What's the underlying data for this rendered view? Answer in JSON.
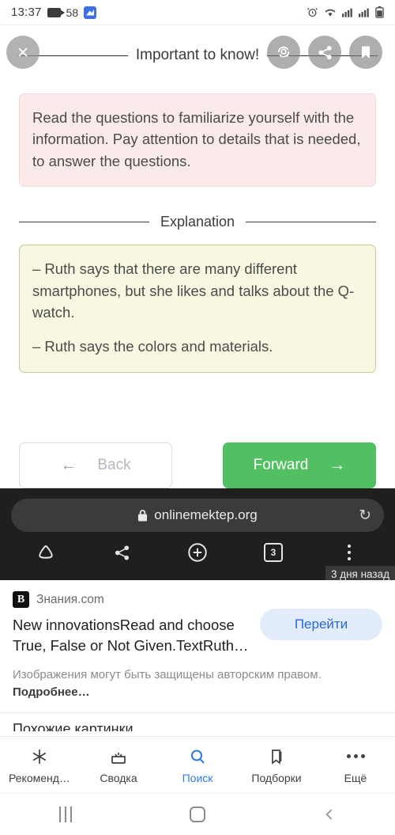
{
  "status_bar": {
    "time": "13:37",
    "notification_count": "58",
    "icons": [
      "video-recording-icon",
      "cleaner-icon",
      "alarm-icon",
      "wifi-icon",
      "signal-icon",
      "signal-icon",
      "battery-icon"
    ]
  },
  "overlay": {
    "close_label": "×",
    "buttons": [
      "close-icon",
      "google-lens-icon",
      "share-icon",
      "bookmark-icon"
    ]
  },
  "page": {
    "title": "Important to know!",
    "alert": "Read the questions to familiarize yourself with the information. Pay attention to details that is needed, to answer the questions.",
    "divider_label": "Explanation",
    "explanation": [
      "– Ruth says that there are many different smartphones, but she likes and talks about the Q-watch.",
      "– Ruth says the colors and materials."
    ],
    "back_label": "Back",
    "forward_label": "Forward",
    "back_arrow": "←",
    "forward_arrow": "→",
    "forward_color": "#53bf63",
    "alert_bg": "#fbeaea",
    "explanation_bg": "#f8f8e2"
  },
  "browser": {
    "url": "onlinemektep.org",
    "lock_icon": "lock-icon",
    "reload_icon": "↻",
    "tab_count": "3",
    "toolbar_icons": [
      "home-icon",
      "share-icon",
      "new-tab-icon",
      "tab-switcher-icon",
      "overflow-menu-icon"
    ],
    "time_ago": "3 дня назад"
  },
  "result": {
    "source_logo": "В",
    "source_name": "Знания.com",
    "title": "New innovationsRead and choose True, False or Not Given.TextRuth…",
    "goto_label": "Перейти",
    "goto_color": "#2a6ad3",
    "copyright_text": "Изображения могут быть защищены авторским правом. ",
    "copyright_more": "Подробнее…",
    "similar_label": "Похожие картинки"
  },
  "app_nav": {
    "items": [
      {
        "label": "Рекоменд…",
        "icon": "asterisk-icon",
        "active": false
      },
      {
        "label": "Сводка",
        "icon": "summary-icon",
        "active": false
      },
      {
        "label": "Поиск",
        "icon": "search-icon",
        "active": true
      },
      {
        "label": "Подборки",
        "icon": "collections-icon",
        "active": false
      },
      {
        "label": "Ещё",
        "icon": "more-icon",
        "active": false
      }
    ],
    "active_color": "#2f7ce0"
  },
  "system_nav": {
    "icons": [
      "recents-icon",
      "home-icon",
      "back-icon"
    ]
  }
}
